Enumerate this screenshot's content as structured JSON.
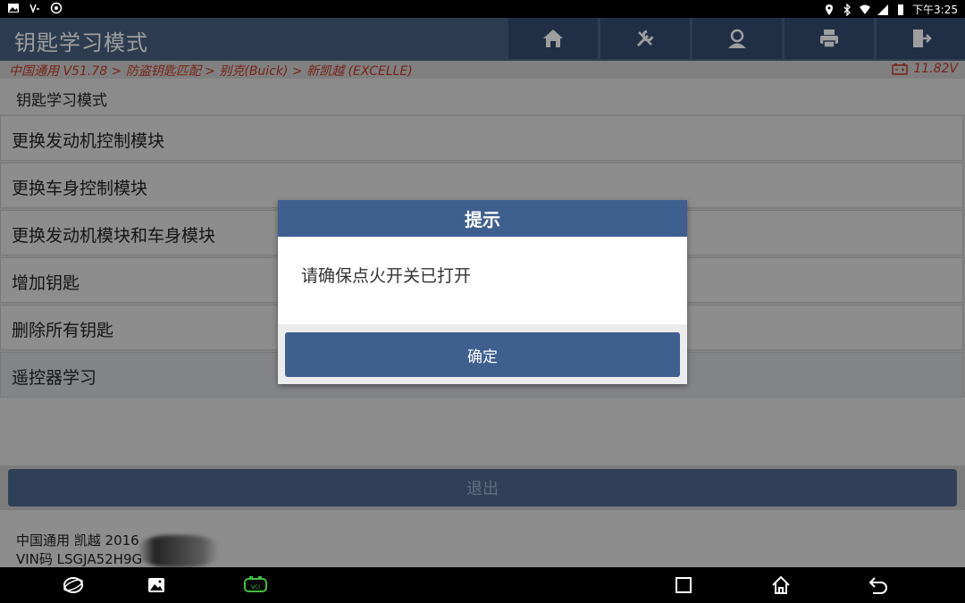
{
  "status_bar": {
    "time": "下午3:25"
  },
  "header": {
    "title": "钥匙学习模式"
  },
  "toolbar": [
    {
      "name": "home-button",
      "icon": "home-icon"
    },
    {
      "name": "diagnostic-tools-button",
      "icon": "tools-icon"
    },
    {
      "name": "user-support-button",
      "icon": "user-icon"
    },
    {
      "name": "print-button",
      "icon": "printer-icon"
    },
    {
      "name": "exit-app-button",
      "icon": "exit-door-icon"
    }
  ],
  "breadcrumb": {
    "text": "中国通用 V51.78 > 防盗钥匙匹配 > 别克(Buick) > 新凯越 (EXCELLE)"
  },
  "battery": {
    "voltage": "11.82V"
  },
  "section": {
    "title": "钥匙学习模式"
  },
  "menu": {
    "items": [
      {
        "label": "更换发动机控制模块"
      },
      {
        "label": "更换车身控制模块"
      },
      {
        "label": "更换发动机模块和车身模块"
      },
      {
        "label": "增加钥匙"
      },
      {
        "label": "删除所有钥匙"
      },
      {
        "label": "遥控器学习"
      }
    ]
  },
  "exit_button": {
    "label": "退出"
  },
  "vehicle_info": {
    "line1": "中国通用 凯越 2016",
    "line2": "VIN码 LSGJA52H9G"
  },
  "dialog": {
    "title": "提示",
    "message": "请确保点火开关已打开",
    "ok_label": "确定"
  },
  "colors": {
    "title_bar": "#4a6182",
    "accent": "#3f5f8f",
    "breadcrumb_text": "#c0392b",
    "vci_icon": "#3fbf3f"
  }
}
